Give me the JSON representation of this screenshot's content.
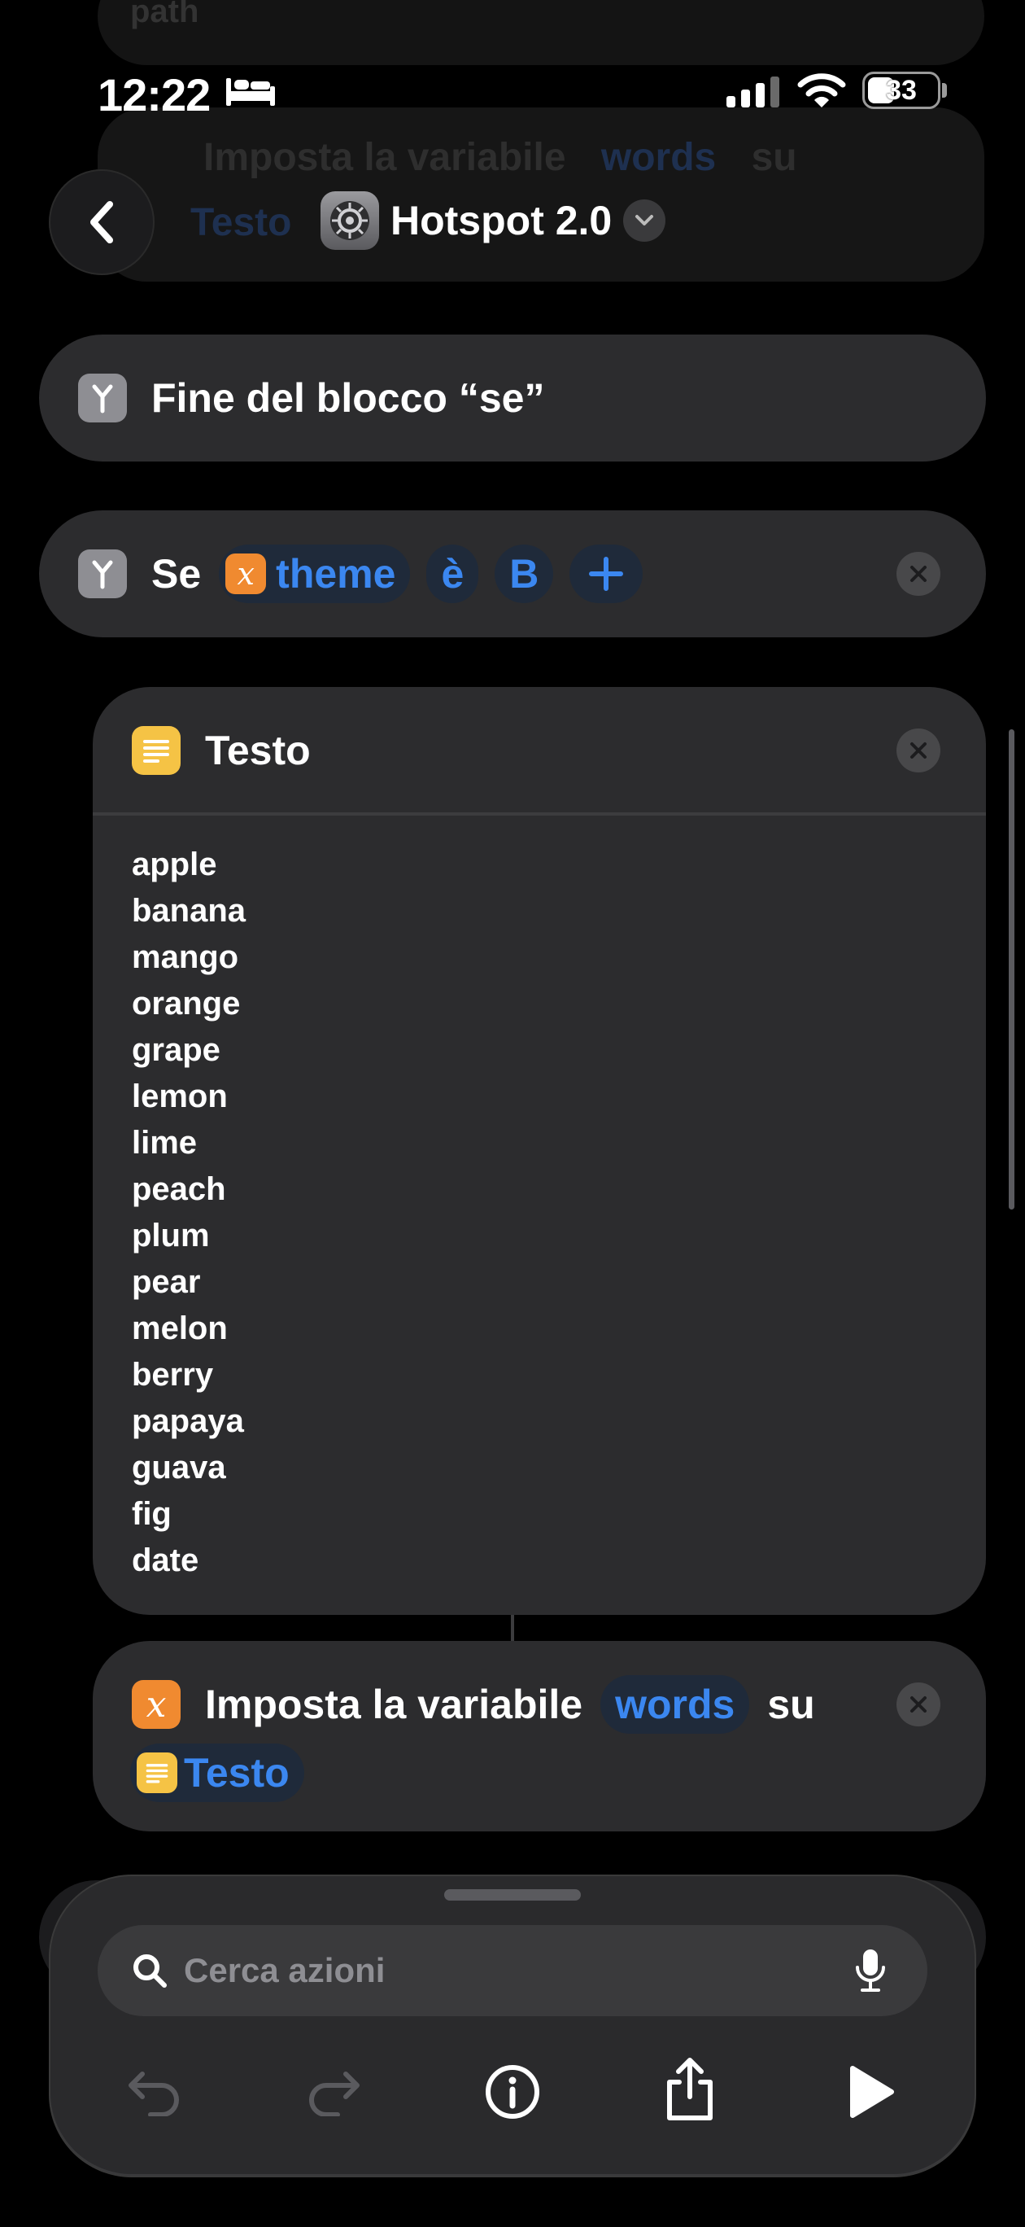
{
  "status_bar": {
    "time": "12:22",
    "battery": "33"
  },
  "header": {
    "title": "Hotspot 2.0"
  },
  "ghost": {
    "top_text": "path",
    "var_label": "Imposta la variabile",
    "var_name": "words",
    "su": "su",
    "testo": "Testo"
  },
  "end_if": {
    "label": "Fine del blocco “se”"
  },
  "if_block": {
    "se": "Se",
    "variable": "theme",
    "operator": "è",
    "value": "B"
  },
  "text_action": {
    "title": "Testo",
    "lines": [
      "apple",
      "banana",
      "mango",
      "orange",
      "grape",
      "lemon",
      "lime",
      "peach",
      "plum",
      "pear",
      "melon",
      "berry",
      "papaya",
      "guava",
      "fig",
      "date"
    ]
  },
  "set_variable": {
    "label": "Imposta la variabile",
    "variable": "words",
    "su": "su",
    "value": "Testo"
  },
  "search": {
    "placeholder": "Cerca azioni"
  },
  "colors": {
    "accent": "#3b87f0",
    "card": "#2c2c2e",
    "variable_orange": "#f08a30",
    "text_yellow": "#f5c345"
  }
}
